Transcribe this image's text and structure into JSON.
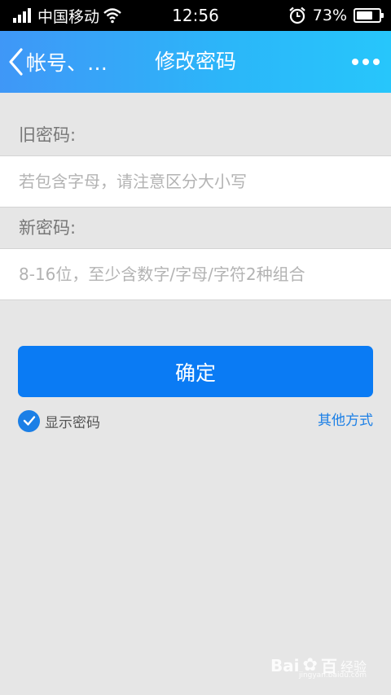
{
  "status_bar": {
    "carrier": "中国移动",
    "time": "12:56",
    "battery": "73%",
    "battery_level": 0.73
  },
  "nav": {
    "back_label": "帐号、…",
    "title": "修改密码",
    "gradient_colors": [
      "#3f97f7",
      "#27c6fb"
    ]
  },
  "form": {
    "old_password": {
      "label": "旧密码:",
      "value": "",
      "placeholder": "若包含字母，请注意区分大小写"
    },
    "new_password": {
      "label": "新密码:",
      "value": "",
      "placeholder": "8-16位，至少含数字/字母/字符2种组合"
    },
    "confirm_label": "确定",
    "show_password": {
      "label": "显示密码",
      "checked": true
    },
    "other_method_label": "其他方式"
  },
  "colors": {
    "accent": "#0a7bf4",
    "link": "#1b7fe6",
    "background": "#e6e6e6"
  },
  "watermark": {
    "brand": "Bai",
    "brand_suffix": "百",
    "product": "经验",
    "url": "jingyan.baidu.com"
  }
}
